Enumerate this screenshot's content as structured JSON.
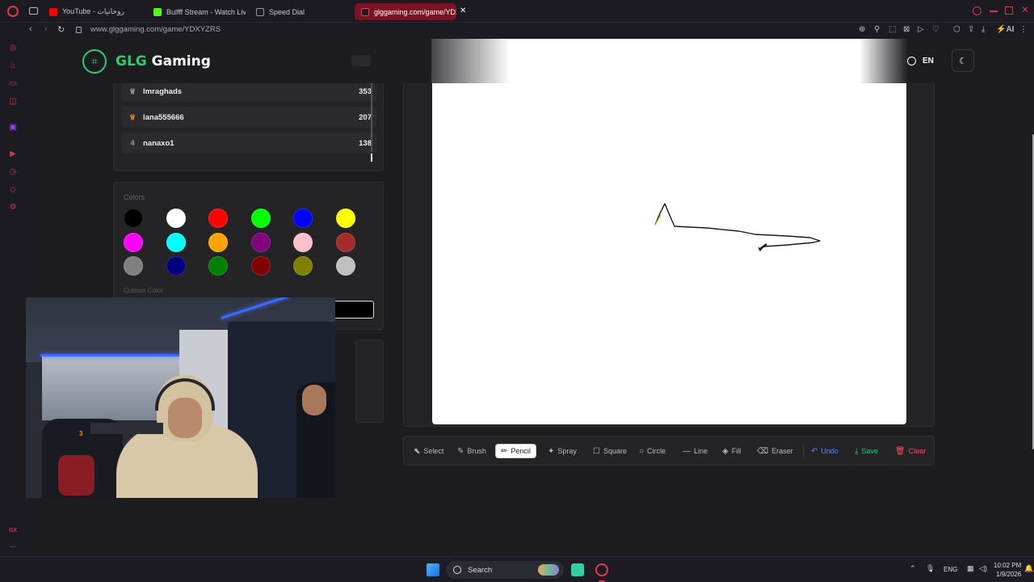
{
  "browser": {
    "tabs": [
      {
        "label": "YouTube - روحانيات",
        "favicon_color": "#ff0000"
      },
      {
        "label": "Bulfff Stream - Watch Live",
        "favicon_color": "#53fc18"
      },
      {
        "label": "Speed Dial",
        "favicon_color": "#888888"
      },
      {
        "label": "glggaming.com/game/YDX",
        "favicon_color": "#e04050"
      }
    ],
    "url": "www.glggaming.com/game/YDXYZRS",
    "ai_label": "AI"
  },
  "header": {
    "brand_accent": "GLG",
    "brand_rest": " Gaming",
    "language": "EN",
    "brand_color": "#2ecc71"
  },
  "leaderboard": [
    {
      "rank": "",
      "rank_icon": "trophy-icon",
      "name": "lmraghads",
      "score": "353"
    },
    {
      "rank": "",
      "rank_icon": "medal-icon",
      "name": "lana555666",
      "score": "207"
    },
    {
      "rank": "4",
      "rank_icon": "",
      "name": "nanaxo1",
      "score": "138"
    }
  ],
  "colors": {
    "title": "Colors",
    "custom_label": "Custom Color",
    "palette": [
      "#000000",
      "#ffffff",
      "#ff0000",
      "#00ff00",
      "#0000ff",
      "#ffff00",
      "#ff00ff",
      "#00ffff",
      "#ffa500",
      "#800080",
      "#ffc0cb",
      "#a52a2a",
      "#808080",
      "#000080",
      "#008000",
      "#800000",
      "#808000",
      "#c0c0c0"
    ]
  },
  "tools": [
    {
      "label": "Select",
      "icon": "cursor-icon",
      "active": false
    },
    {
      "label": "Brush",
      "icon": "brush-icon",
      "active": false
    },
    {
      "label": "Pencil",
      "icon": "pencil-icon",
      "active": true
    },
    {
      "label": "Spray",
      "icon": "spray-icon",
      "active": false
    },
    {
      "label": "Square",
      "icon": "square-icon",
      "active": false
    },
    {
      "label": "Circle",
      "icon": "circle-icon",
      "active": false
    },
    {
      "label": "Line",
      "icon": "line-icon",
      "active": false
    },
    {
      "label": "Fill",
      "icon": "fill-icon",
      "active": false
    },
    {
      "label": "Eraser",
      "icon": "eraser-icon",
      "active": false
    }
  ],
  "actions": {
    "undo": "Undo",
    "save": "Save",
    "clear": "Clear",
    "undo_color": "#4a8cff",
    "save_color": "#2ecc71",
    "clear_color": "#ff4d5e"
  },
  "webcam": {
    "badge_number": "3"
  },
  "taskbar": {
    "search_label": "Search",
    "language": "ENG",
    "time": "10:02 PM",
    "date": "1/9/2026"
  },
  "sidebar": {
    "gx_label": "GX",
    "more_label": "..."
  }
}
